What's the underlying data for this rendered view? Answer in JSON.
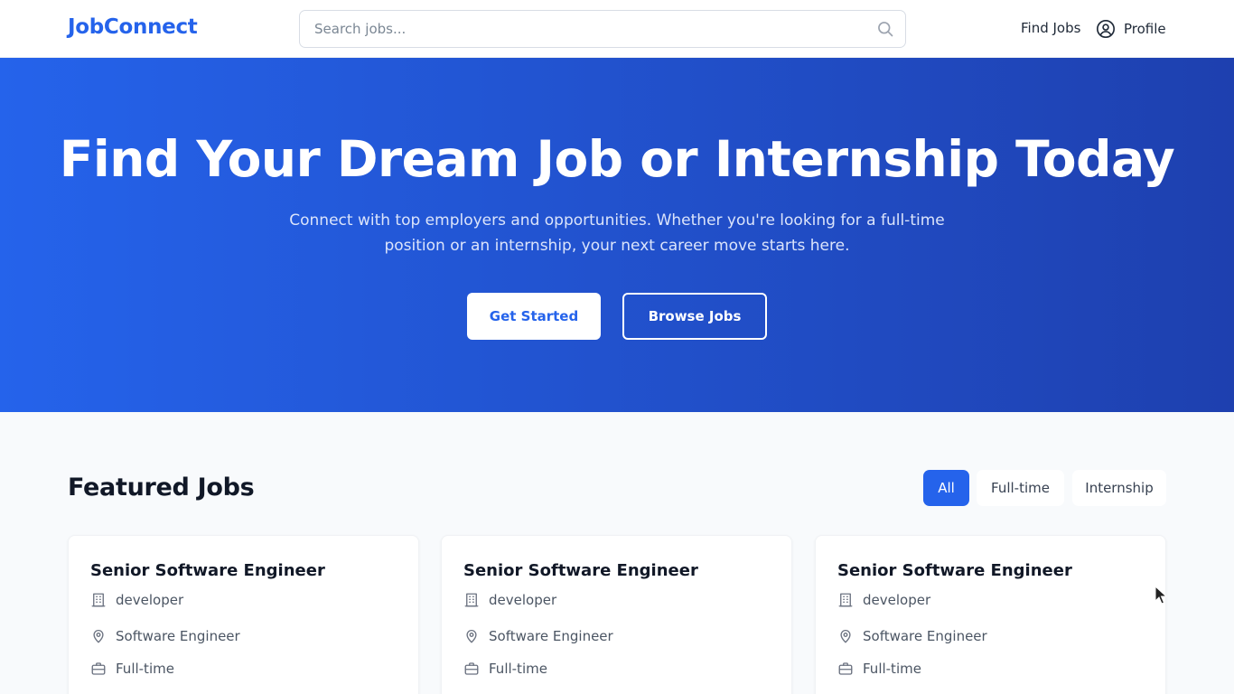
{
  "header": {
    "logo": "JobConnect",
    "search_placeholder": "Search jobs...",
    "search_icon": "search-icon",
    "nav_find_jobs": "Find Jobs",
    "nav_profile": "Profile",
    "profile_icon": "user-circle-icon"
  },
  "hero": {
    "title": "Find Your Dream Job or Internship Today",
    "subtitle_line1": "Connect with top employers and opportunities. Whether you're looking for a full-time",
    "subtitle_line2": "position or an internship, your next career move starts here.",
    "primary_button": "Get Started",
    "secondary_button": "Browse Jobs",
    "gradient_start": "#2563eb",
    "gradient_end": "#1e40af"
  },
  "featured": {
    "title": "Featured Jobs",
    "filters": [
      {
        "label": "All",
        "active": true
      },
      {
        "label": "Full-time",
        "active": false
      },
      {
        "label": "Internship",
        "active": false
      }
    ],
    "jobs": [
      {
        "title": "Senior Software Engineer",
        "company": "developer",
        "location": "Software Engineer",
        "type": "Full-time"
      },
      {
        "title": "Senior Software Engineer",
        "company": "developer",
        "location": "Software Engineer",
        "type": "Full-time"
      },
      {
        "title": "Senior Software Engineer",
        "company": "developer",
        "location": "Software Engineer",
        "type": "Full-time"
      }
    ]
  },
  "colors": {
    "accent": "#2563eb",
    "page_background": "#f8fafc"
  }
}
